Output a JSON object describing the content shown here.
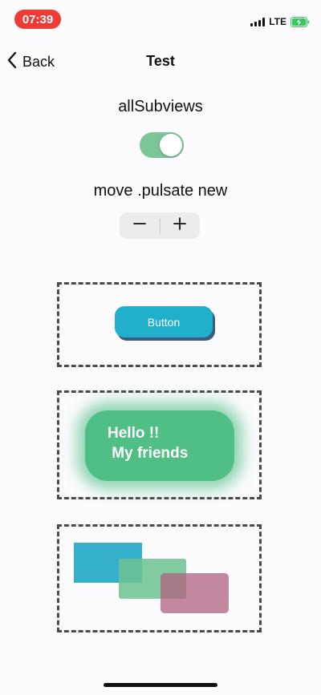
{
  "status_bar": {
    "time": "07:39",
    "network": "LTE",
    "time_bg_color": "#ef3b36",
    "battery_color": "#34c759"
  },
  "nav": {
    "back_label": "Back",
    "title": "Test"
  },
  "controls": {
    "toggle_label": "allSubviews",
    "toggle_on": true,
    "toggle_color": "#7cc597",
    "stepper_label": "move .pulsate new",
    "stepper_minus": "−",
    "stepper_plus": "+"
  },
  "demos": {
    "button_label": "Button",
    "button_color": "#20b0cc",
    "hello_text": "Hello !!\n My friends",
    "hello_color": "#4fbf85",
    "rect_colors": [
      "#20a9c6",
      "#6cc290",
      "#b0607f"
    ]
  }
}
